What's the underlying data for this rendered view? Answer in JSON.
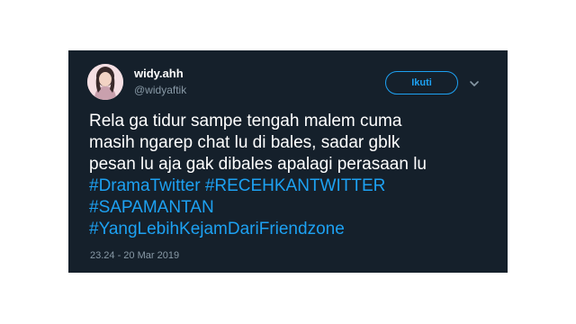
{
  "user": {
    "display_name": "widy.ahh",
    "handle": "@widyaftik",
    "avatar_icon": "profile-photo"
  },
  "follow_button": {
    "label": "Ikuti"
  },
  "menu_icon": "chevron-down-icon",
  "tweet": {
    "lines": [
      "Rela ga tidur sampe tengah malem cuma",
      "masih ngarep chat lu di bales, sadar gblk",
      "pesan lu aja gak dibales apalagi perasaan lu"
    ],
    "hashtags": [
      "#DramaTwitter",
      "#RECEHKANTWITTER",
      "#SAPAMANTAN",
      "#YangLebihKejamDariFriendzone"
    ]
  },
  "timestamp": "23.24 - 20 Mar 2019",
  "colors": {
    "background": "#15202b",
    "accent": "#1da1f2",
    "secondary_text": "#8899a6"
  }
}
